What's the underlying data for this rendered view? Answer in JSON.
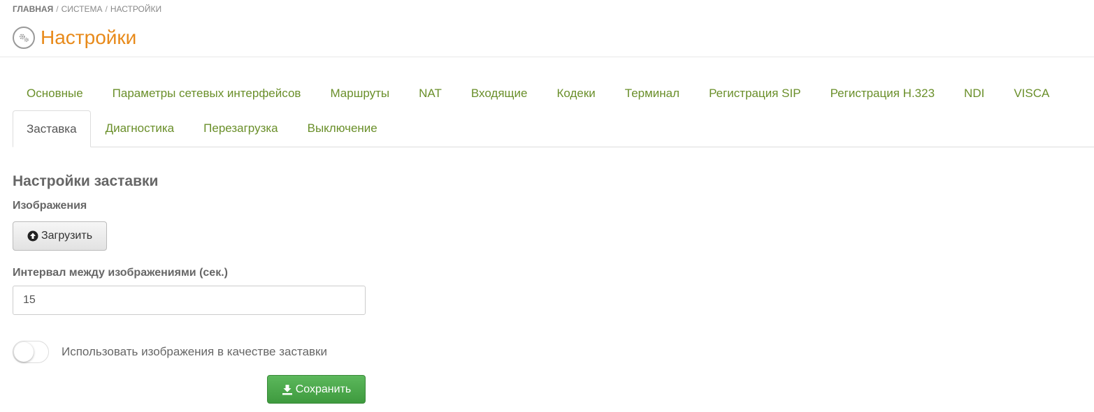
{
  "breadcrumb": {
    "home": "ГЛАВНАЯ",
    "system": "СИСТЕМА",
    "current": "НАСТРОЙКИ",
    "separator": "/"
  },
  "header": {
    "title": "Настройки",
    "icon": "gear-icon"
  },
  "tabs_row1": [
    "Основные",
    "Параметры сетевых интерфейсов",
    "Маршруты",
    "NAT",
    "Входящие",
    "Кодеки",
    "Терминал",
    "Регистрация SIP",
    "Регистрация H.323",
    "NDI",
    "VISCA"
  ],
  "tabs_row2": [
    "Заставка",
    "Диагностика",
    "Перезагрузка",
    "Выключение"
  ],
  "active_tab": "Заставка",
  "colors": {
    "accent_title": "#e88a1a",
    "tab_link": "#6a8f2a",
    "save_button": "#4cae4c"
  },
  "form": {
    "section_title": "Настройки заставки",
    "images_label": "Изображения",
    "upload_label": "Загрузить",
    "upload_icon": "arrow-up-circle-icon",
    "interval_label": "Интервал между изображениями (сек.)",
    "interval_value": "15",
    "use_images_label": "Использовать изображения в качестве заставки",
    "use_images_enabled": false,
    "save_label": "Сохранить",
    "save_icon": "download-icon"
  }
}
